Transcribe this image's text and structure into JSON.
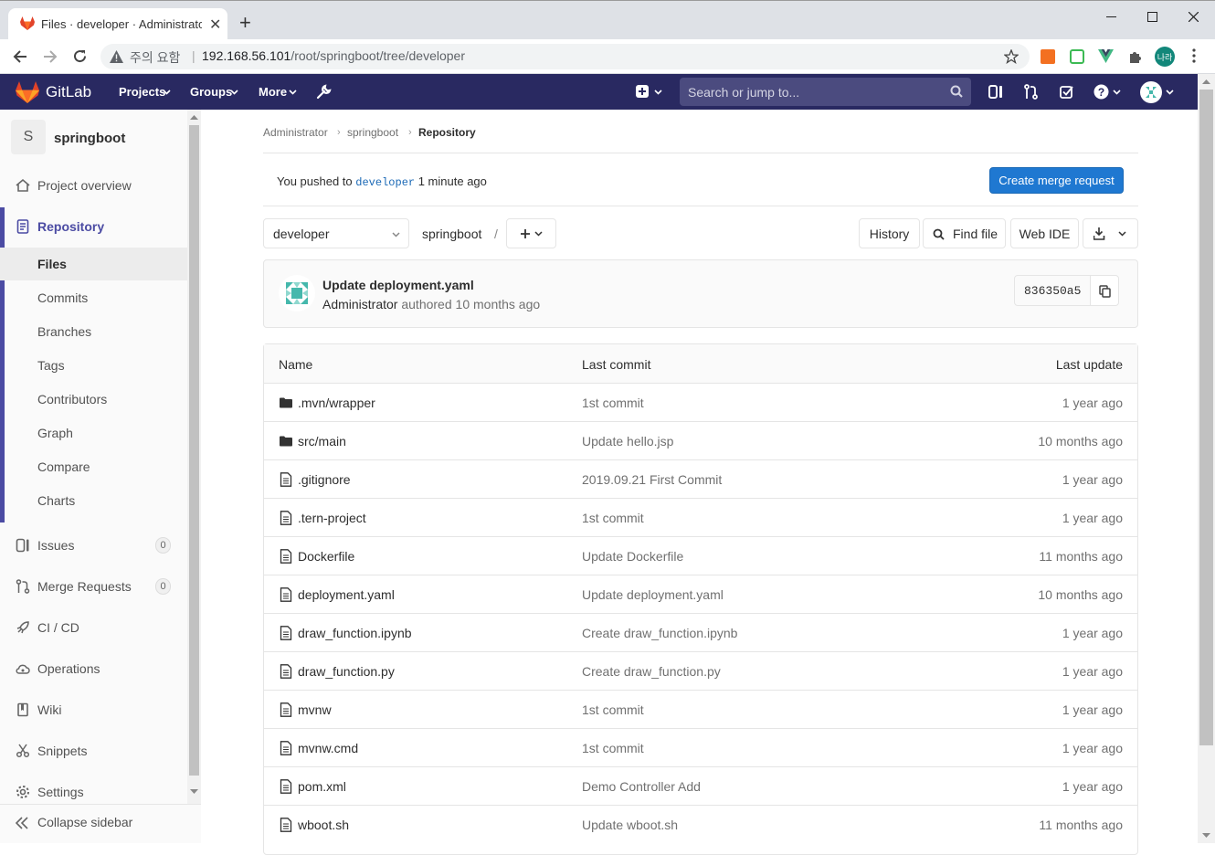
{
  "browser": {
    "tab_title": "Files · developer · Administrator",
    "url_warning": "주의 요함",
    "url_host": "192.168.56.101",
    "url_path": "/root/springboot/tree/developer",
    "profile_label": "나라"
  },
  "gitlab_nav": {
    "brand": "GitLab",
    "projects": "Projects",
    "groups": "Groups",
    "more": "More",
    "search_placeholder": "Search or jump to..."
  },
  "sidebar": {
    "project_initial": "S",
    "project_name": "springboot",
    "project_overview": "Project overview",
    "repository": "Repository",
    "repo_items": [
      "Files",
      "Commits",
      "Branches",
      "Tags",
      "Contributors",
      "Graph",
      "Compare",
      "Charts"
    ],
    "issues": "Issues",
    "issues_count": "0",
    "merge_requests": "Merge Requests",
    "merge_requests_count": "0",
    "cicd": "CI / CD",
    "operations": "Operations",
    "wiki": "Wiki",
    "snippets": "Snippets",
    "settings": "Settings",
    "collapse": "Collapse sidebar"
  },
  "breadcrumb": [
    "Administrator",
    "springboot",
    "Repository"
  ],
  "push_notice": {
    "prefix": "You pushed to",
    "branch": "developer",
    "suffix": "1 minute ago",
    "button": "Create merge request"
  },
  "repo_toolbar": {
    "branch": "developer",
    "path_root": "springboot",
    "path_sep": "/",
    "history": "History",
    "find_file": "Find file",
    "web_ide": "Web IDE"
  },
  "last_commit": {
    "title": "Update deployment.yaml",
    "author": "Administrator",
    "authored": "authored",
    "time": "10 months ago",
    "sha": "836350a5"
  },
  "file_table": {
    "headers": {
      "name": "Name",
      "last_commit": "Last commit",
      "last_update": "Last update"
    },
    "rows": [
      {
        "type": "folder",
        "name": ".mvn/wrapper",
        "commit": "1st commit",
        "updated": "1 year ago"
      },
      {
        "type": "folder",
        "name": "src/main",
        "commit": "Update hello.jsp",
        "updated": "10 months ago"
      },
      {
        "type": "file",
        "name": ".gitignore",
        "commit": "2019.09.21 First Commit",
        "updated": "1 year ago"
      },
      {
        "type": "file",
        "name": ".tern-project",
        "commit": "1st commit",
        "updated": "1 year ago"
      },
      {
        "type": "file",
        "name": "Dockerfile",
        "commit": "Update Dockerfile",
        "updated": "11 months ago"
      },
      {
        "type": "file",
        "name": "deployment.yaml",
        "commit": "Update deployment.yaml",
        "updated": "10 months ago"
      },
      {
        "type": "file",
        "name": "draw_function.ipynb",
        "commit": "Create draw_function.ipynb",
        "updated": "1 year ago"
      },
      {
        "type": "file",
        "name": "draw_function.py",
        "commit": "Create draw_function.py",
        "updated": "1 year ago"
      },
      {
        "type": "file",
        "name": "mvnw",
        "commit": "1st commit",
        "updated": "1 year ago"
      },
      {
        "type": "file",
        "name": "mvnw.cmd",
        "commit": "1st commit",
        "updated": "1 year ago"
      },
      {
        "type": "file",
        "name": "pom.xml",
        "commit": "Demo Controller Add",
        "updated": "1 year ago"
      },
      {
        "type": "file",
        "name": "wboot.sh",
        "commit": "Update wboot.sh",
        "updated": "11 months ago"
      }
    ]
  },
  "colors": {
    "nav_bg": "#292961",
    "accent": "#1f78d1",
    "sidebar_active": "#4b4ba3"
  }
}
